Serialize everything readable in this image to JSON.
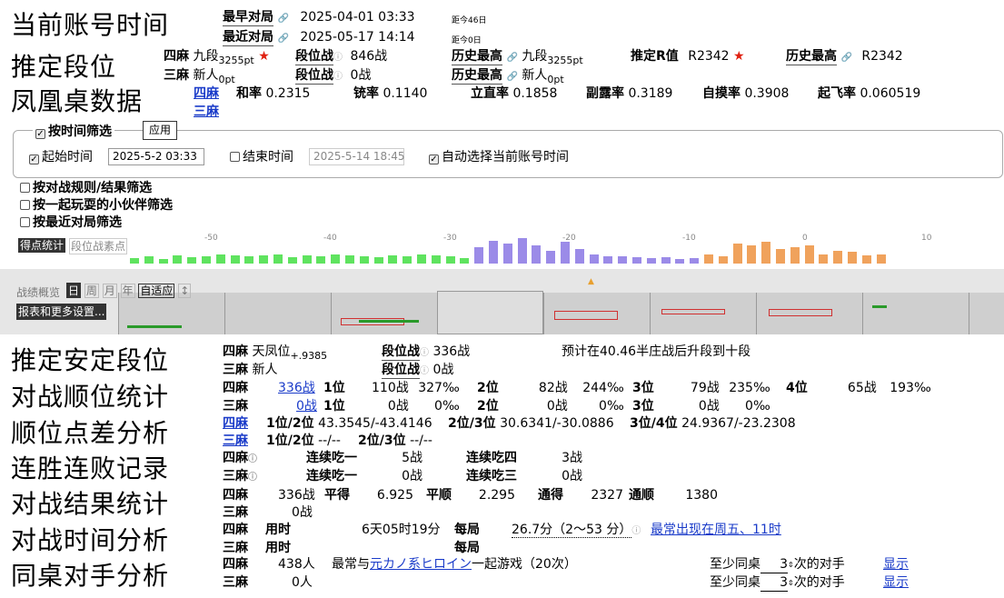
{
  "sections": [
    "当前账号时间",
    "推定段位",
    "凤凰桌数据",
    "推定安定段位",
    "对战顺位统计",
    "顺位点差分析",
    "连胜连败记录",
    "对战结果统计",
    "对战时间分析",
    "同桌对手分析"
  ],
  "time": {
    "earliest_label": "最早对局",
    "earliest": "2025-04-01 03:33",
    "earliest_note": "距今46日",
    "latest_label": "最近对局",
    "latest": "2025-05-17 14:14",
    "latest_note": "距今0日"
  },
  "rank": {
    "yonma": {
      "label": "四麻",
      "dan": "九段",
      "pt": "3255pt",
      "dan_battle_label": "段位战",
      "dan_battle": "846战",
      "hist_label": "历史最高",
      "hist": "九段",
      "hist_pt": "3255pt"
    },
    "sanma": {
      "label": "三麻",
      "dan": "新人",
      "pt": "0pt",
      "dan_battle_label": "段位战",
      "dan_battle": "0战",
      "hist_label": "历史最高",
      "hist": "新人",
      "hist_pt": "0pt"
    },
    "r_label": "推定R值",
    "r_value": "R2342",
    "r_hist_label": "历史最高",
    "r_hist": "R2342"
  },
  "phoenix": {
    "tab1": "四麻",
    "tab2": "三麻",
    "stats": [
      [
        "和率",
        "0.2315"
      ],
      [
        "铳率",
        "0.1140"
      ],
      [
        "立直率",
        "0.1858"
      ],
      [
        "副露率",
        "0.3189"
      ],
      [
        "自摸率",
        "0.3908"
      ],
      [
        "起飞率",
        "0.060519"
      ]
    ]
  },
  "filter": {
    "time_filter": "按时间筛选",
    "apply": "应用",
    "start_label": "起始时间",
    "start": "2025-5-2 03:33",
    "end_label": "结束时间",
    "end": "2025-5-14 18:45",
    "auto": "自动选择当前账号时间",
    "rule_filter": "按对战规则/结果筛选",
    "friend_filter": "按一起玩耍的小伙伴筛选",
    "recent_filter": "按最近对局筛选"
  },
  "chart": {
    "tab1": "得点统计",
    "tab2": "段位战素点",
    "ticks": [
      "-50",
      "-40",
      "-30",
      "-20",
      "-10",
      "0",
      "10"
    ]
  },
  "overview": {
    "label": "战绩概览",
    "modes": [
      "日",
      "周",
      "月",
      "年",
      "自适应",
      "↕"
    ],
    "report": "报表和更多设置..."
  },
  "stable": {
    "yonma_label": "四麻",
    "yonma": "天凤位",
    "yonma_sub": "+.9385",
    "battle_label": "段位战",
    "yonma_battle": "336战",
    "predict": "预计在40.46半庄战后升段到十段",
    "sanma_label": "三麻",
    "sanma": "新人",
    "sanma_battle": "0战"
  },
  "order": {
    "yonma": {
      "label": "四麻",
      "games": "336战",
      "cols": [
        [
          "1位",
          "110战",
          "327‰"
        ],
        [
          "2位",
          "82战",
          "244‰"
        ],
        [
          "3位",
          "79战",
          "235‰"
        ],
        [
          "4位",
          "65战",
          "193‰"
        ]
      ]
    },
    "sanma": {
      "label": "三麻",
      "games": "0战",
      "cols": [
        [
          "1位",
          "0战",
          "0‰"
        ],
        [
          "2位",
          "0战",
          "0‰"
        ],
        [
          "3位",
          "0战",
          "0‰"
        ]
      ]
    }
  },
  "diff": {
    "yonma": {
      "label": "四麻",
      "items": [
        [
          "1位/2位",
          "43.3545/-43.4146"
        ],
        [
          "2位/3位",
          "30.6341/-30.0886"
        ],
        [
          "3位/4位",
          "24.9367/-23.2308"
        ]
      ]
    },
    "sanma": {
      "label": "三麻",
      "items": [
        [
          "1位/2位",
          "--/--"
        ],
        [
          "2位/3位",
          "--/--"
        ]
      ]
    }
  },
  "streak": {
    "yonma": {
      "label": "四麻",
      "a_label": "连续吃一",
      "a": "5战",
      "b_label": "连续吃四",
      "b": "3战"
    },
    "sanma": {
      "label": "三麻",
      "a_label": "连续吃一",
      "a": "0战",
      "b_label": "连续吃三",
      "b": "0战"
    }
  },
  "result": {
    "yonma": {
      "label": "四麻",
      "games": "336战",
      "items": [
        [
          "平得",
          "6.925"
        ],
        [
          "平顺",
          "2.295"
        ],
        [
          "通得",
          "2327"
        ],
        [
          "通顺",
          "1380"
        ]
      ]
    },
    "sanma": {
      "label": "三麻",
      "games": "0战"
    }
  },
  "timeana": {
    "yonma": {
      "label": "四麻",
      "used_label": "用时",
      "used": "6天05时19分",
      "per_label": "每局",
      "per": "26.7分（2～53 分）",
      "often": "最常出现在周五、11时"
    },
    "sanma": {
      "label": "三麻",
      "used_label": "用时",
      "per_label": "每局"
    }
  },
  "opp": {
    "yonma": {
      "label": "四麻",
      "count": "438人",
      "text1": "最常与",
      "name": "元カノ系ヒロイン",
      "text2": "一起游戏（20次）",
      "min_label": "至少同桌",
      "min": "3",
      "min_suffix": "次的对手",
      "show": "显示"
    },
    "sanma": {
      "label": "三麻",
      "count": "0人",
      "min_label": "至少同桌",
      "min": "3",
      "min_suffix": "次的对手",
      "show": "显示"
    }
  },
  "colors": {
    "green": "#5fe35f",
    "purple": "#9b8be8",
    "orange": "#f0a25c",
    "link": "#1a3bc9",
    "star": "#e02010"
  }
}
